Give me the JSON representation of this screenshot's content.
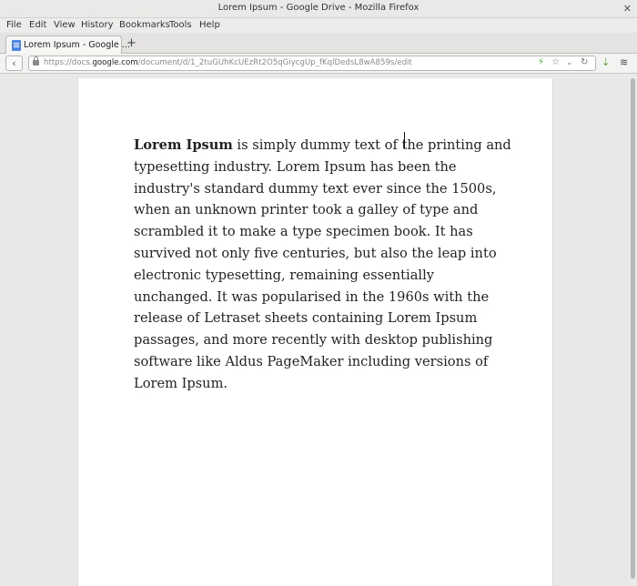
{
  "window": {
    "title": "Lorem Ipsum - Google Drive - Mozilla Firefox"
  },
  "menu": [
    "File",
    "Edit",
    "View",
    "History",
    "Bookmarks",
    "Tools",
    "Help"
  ],
  "tab": {
    "label": "Lorem Ipsum - Google ...",
    "new_tab": "+"
  },
  "nav": {
    "url_prefix": "https://docs.",
    "url_domain": "google.com",
    "url_path": "/document/d/1_2tuGUhKcUEzRt2O5qGiycgUp_fKqlDedsL8wA859s/edit"
  },
  "document": {
    "bold_lead": "Lorem Ipsum",
    "body": " is simply dummy text of the printing and typesetting industry. Lorem Ipsum has been the industry's standard dummy text ever since the 1500s, when an unknown printer took a galley of type and scrambled it to make a type specimen book. It has survived not only five centuries, but also the leap into electronic typesetting, remaining essentially unchanged. It was popularised in the 1960s with the release of Letraset sheets containing Lorem Ipsum passages, and more recently with desktop publishing software like Aldus PageMaker including versions of Lorem Ipsum."
  },
  "icons": {
    "back": "back-arrow-icon",
    "lock": "lock-icon",
    "bolt": "lightning-icon",
    "bookmark": "star-icon",
    "dropdown": "chevron-down-icon",
    "reload": "reload-icon",
    "download": "download-icon",
    "pocket": "layers-icon"
  }
}
